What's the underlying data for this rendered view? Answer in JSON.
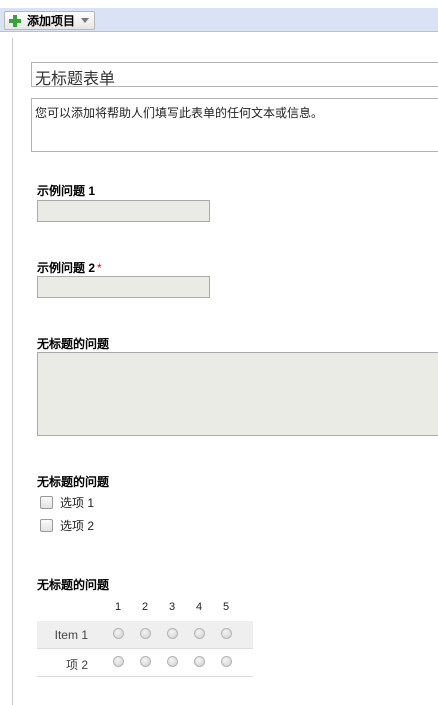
{
  "toolbar": {
    "add_item_label": "添加项目"
  },
  "form": {
    "title": "无标题表单",
    "description": "您可以添加将帮助人们填写此表单的任何文本或信息。"
  },
  "questions": [
    {
      "label": "示例问题 1",
      "type": "text"
    },
    {
      "label": "示例问题 2",
      "required_mark": "*",
      "type": "text"
    },
    {
      "label": "无标题的问题",
      "type": "paragraph"
    },
    {
      "label": "无标题的问题",
      "type": "checkbox",
      "options": [
        "选项 1",
        "选项 2"
      ]
    },
    {
      "label": "无标题的问题",
      "type": "grid",
      "columns": [
        "1",
        "2",
        "3",
        "4",
        "5"
      ],
      "rows": [
        "Item 1",
        "项 2"
      ]
    }
  ],
  "colors": {
    "toolbar_bg": "#d9e3f5",
    "input_bg": "#ebebe6",
    "required": "#cc1111",
    "plus": "#3aa23a"
  }
}
